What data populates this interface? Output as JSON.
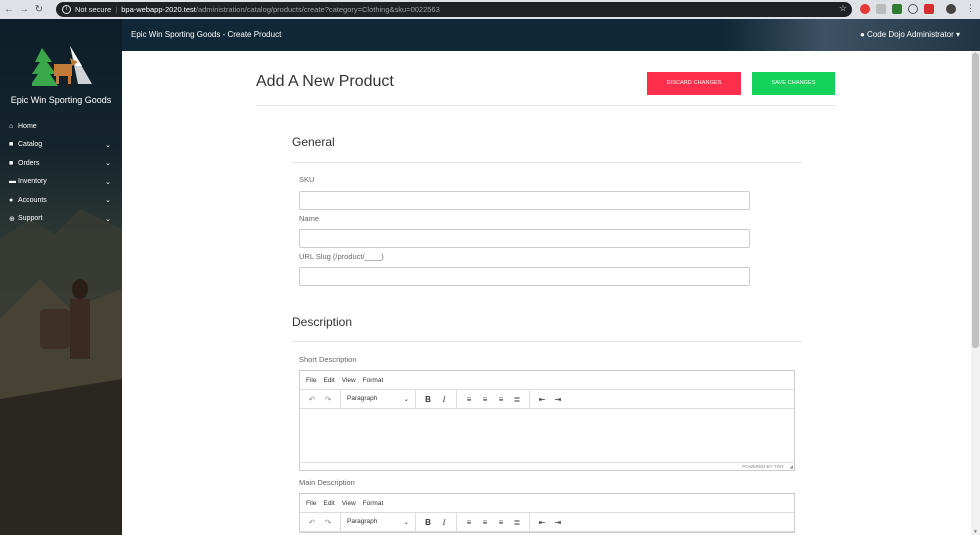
{
  "browser": {
    "security_label": "Not secure",
    "url_host": "bpa-webapp-2020.test",
    "url_path": "/administration/catalog/products/create?category=Clothing&sku=0022563"
  },
  "sidebar": {
    "brand": "Epic Win Sporting Goods",
    "items": [
      {
        "label": "Home",
        "icon": "home-icon",
        "has_chevron": false
      },
      {
        "label": "Catalog",
        "icon": "shopping-bag-icon",
        "has_chevron": true
      },
      {
        "label": "Orders",
        "icon": "receipt-icon",
        "has_chevron": true
      },
      {
        "label": "Inventory",
        "icon": "truck-icon",
        "has_chevron": true
      },
      {
        "label": "Accounts",
        "icon": "user-icon",
        "has_chevron": true
      },
      {
        "label": "Support",
        "icon": "support-icon",
        "has_chevron": true
      }
    ]
  },
  "topbar": {
    "title": "Epic Win Sporting Goods - Create Product",
    "user": "Code Dojo Administrator"
  },
  "page": {
    "title": "Add A New Product",
    "discard_label": "DISCARD CHANGES",
    "save_label": "SAVE CHANGES"
  },
  "general": {
    "title": "General",
    "sku_label": "SKU",
    "sku_value": "",
    "name_label": "Name",
    "name_value": "",
    "slug_label": "URL Slug (/product/____)",
    "slug_value": ""
  },
  "description": {
    "title": "Description",
    "short_label": "Short Description",
    "main_label": "Main Description"
  },
  "editor": {
    "menu": [
      "File",
      "Edit",
      "View",
      "Format"
    ],
    "block_format": "Paragraph",
    "powered_by": "POWERED BY TINY"
  },
  "colors": {
    "discard": "#ff2e4b",
    "save": "#14d35b",
    "topbar": "#0f2736"
  }
}
